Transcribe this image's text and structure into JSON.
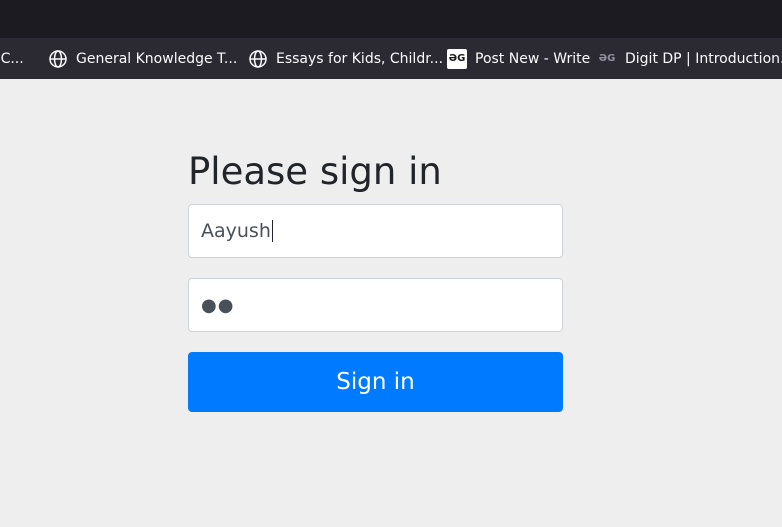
{
  "bookmarks": [
    {
      "label": "J C...",
      "icon": "none"
    },
    {
      "label": "General Knowledge T...",
      "icon": "globe-icon"
    },
    {
      "label": "Essays for Kids, Childr...",
      "icon": "globe-icon"
    },
    {
      "label": "Post New - Write",
      "icon": "gfg-logo",
      "logo_text": "ƏG"
    },
    {
      "label": "Digit DP | Introduction...",
      "icon": "gfg-logo",
      "logo_text": "ƏG"
    }
  ],
  "signin": {
    "title": "Please sign in",
    "username_value": "Aayush",
    "password_mask": "●●",
    "button_label": "Sign in"
  },
  "colors": {
    "accent": "#007bff",
    "page_bg": "#eeeeee",
    "toolbar_bg": "#2b2a33",
    "titlebar_bg": "#1c1b22"
  }
}
